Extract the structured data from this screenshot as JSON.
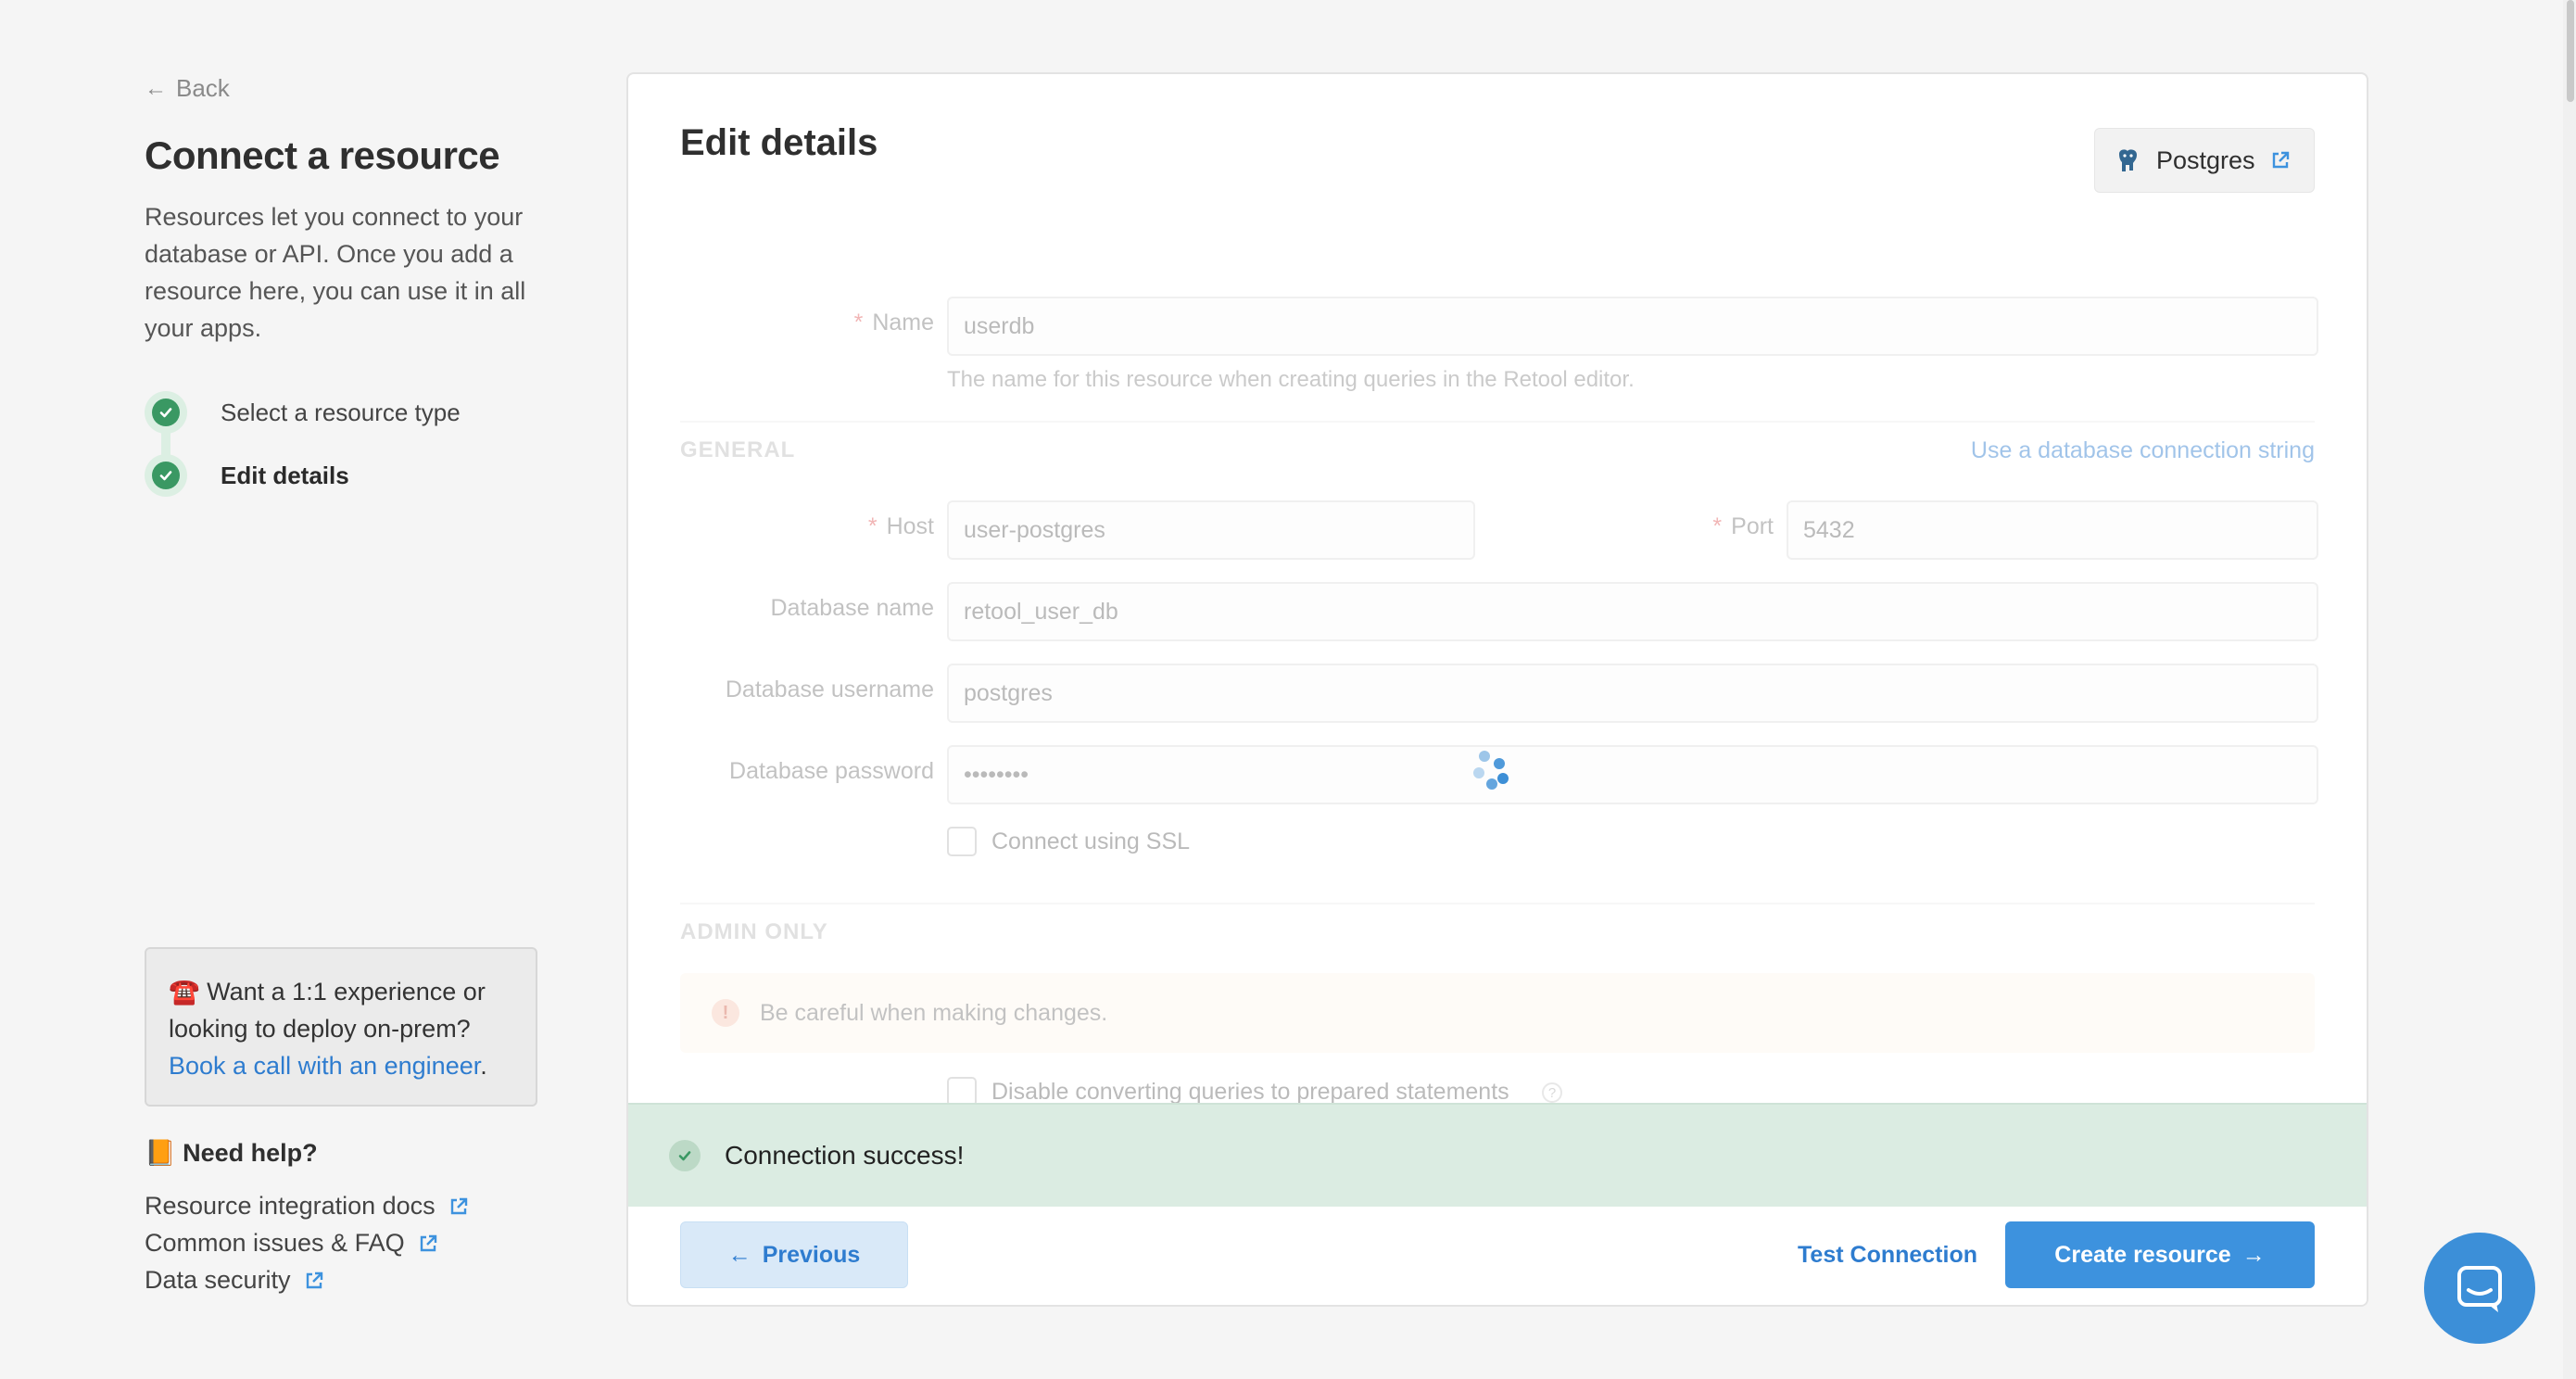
{
  "left": {
    "back_label": "Back",
    "title": "Connect a resource",
    "description": "Resources let you connect to your database or API. Once you add a resource here, you can use it in all your apps.",
    "steps": [
      {
        "label": "Select a resource type",
        "status": "complete"
      },
      {
        "label": "Edit details",
        "status": "active"
      }
    ],
    "promo": {
      "emoji": "☎️",
      "text": "Want a 1:1 experience or looking to deploy on-prem?",
      "link": "Book a call with an engineer",
      "suffix": "."
    },
    "help": {
      "emoji": "📙",
      "title": "Need help?",
      "links": [
        "Resource integration docs",
        "Common issues & FAQ",
        "Data security"
      ]
    }
  },
  "card": {
    "title": "Edit details",
    "resource_type_button": "Postgres",
    "name": {
      "label": "Name",
      "value": "userdb",
      "hint": "The name for this resource when creating queries in the Retool editor."
    },
    "general": {
      "section_title": "GENERAL",
      "connection_string_link": "Use a database connection string",
      "host": {
        "label": "Host",
        "value": "user-postgres"
      },
      "port": {
        "label": "Port",
        "value": "5432"
      },
      "database_name": {
        "label": "Database name",
        "value": "retool_user_db"
      },
      "database_username": {
        "label": "Database username",
        "value": "postgres"
      },
      "database_password": {
        "label": "Database password",
        "value": "••••••••"
      },
      "ssl_label": "Connect using SSL"
    },
    "admin": {
      "section_title": "ADMIN ONLY",
      "warning": "Be careful when making changes.",
      "prepared_label": "Disable converting queries to prepared statements"
    },
    "toast": "Connection success!",
    "footer": {
      "previous": "Previous",
      "test_connection": "Test Connection",
      "create": "Create resource"
    }
  },
  "colors": {
    "accent": "#3d92de",
    "success_bg": "#dbece2",
    "check_green": "#3a9863"
  }
}
